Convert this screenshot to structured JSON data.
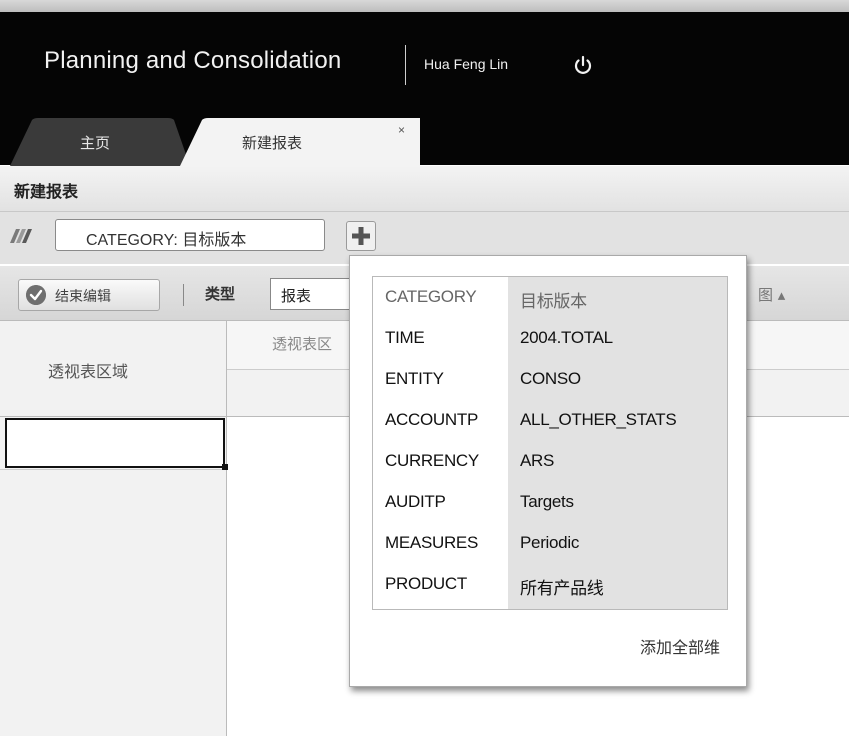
{
  "header": {
    "app_title": "Planning and Consolidation",
    "user_name": "Hua Feng Lin",
    "power_icon": "power-icon"
  },
  "tabs": [
    {
      "label": "主页"
    },
    {
      "label": "新建报表",
      "close": "×"
    }
  ],
  "page": {
    "title": "新建报表"
  },
  "context": {
    "chip_text": "CATEGORY: 目标版本",
    "icon": "dimension-icon",
    "add_icon": "plus-icon"
  },
  "toolbar": {
    "end_edit_label": "结束编辑",
    "type_label": "类型",
    "type_value": "报表",
    "right_partial": "图 ▴"
  },
  "grid": {
    "pivot_area_label": "透视表区域",
    "pivot_area_header": "透视表区"
  },
  "popup": {
    "rows": [
      {
        "dim": "CATEGORY",
        "member": "目标版本"
      },
      {
        "dim": "TIME",
        "member": "2004.TOTAL"
      },
      {
        "dim": "ENTITY",
        "member": "CONSO"
      },
      {
        "dim": "ACCOUNTP",
        "member": "ALL_OTHER_STATS"
      },
      {
        "dim": "CURRENCY",
        "member": "ARS"
      },
      {
        "dim": "AUDITP",
        "member": "Targets"
      },
      {
        "dim": "MEASURES",
        "member": "Periodic"
      },
      {
        "dim": "PRODUCT",
        "member": "所有产品线"
      }
    ],
    "add_all_label": "添加全部维"
  },
  "colors": {
    "header_bg": "#050505",
    "toolbar_bg": "#dcdcdc",
    "member_col_bg": "#e2e2e2"
  }
}
